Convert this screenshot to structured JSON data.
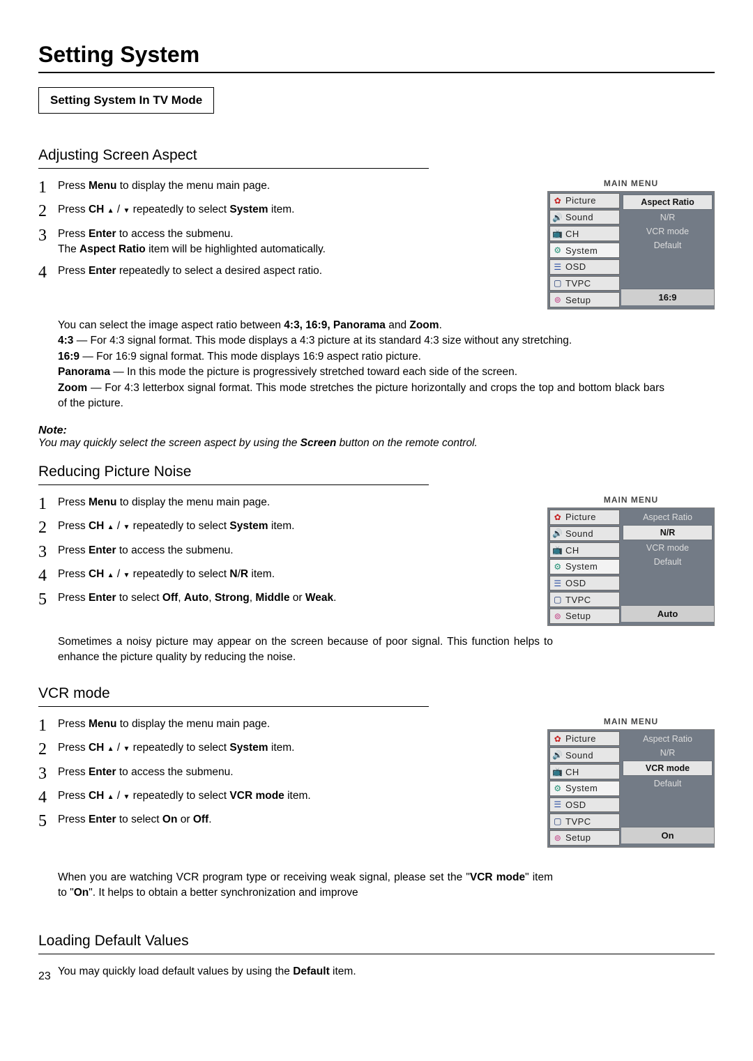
{
  "page_title": "Setting System",
  "subtitle_box": "Setting System In TV Mode",
  "page_number": "23",
  "section1": {
    "title": "Adjusting Screen Aspect",
    "steps": [
      {
        "n": "1",
        "html": "Press  <b>Menu</b> to display the menu main page."
      },
      {
        "n": "2",
        "html": "Press <b>CH</b> <span class='icon-tri-up'></span> / <span class='icon-tri-down'></span>  repeatedly to select <b>System</b> item."
      },
      {
        "n": "3",
        "html": "Press <b>Enter</b> to access the submenu.<br>The <b>Aspect Ratio</b> item will be highlighted automatically."
      },
      {
        "n": "4",
        "html": "Press <b>Enter</b> repeatedly to select a desired aspect ratio."
      }
    ],
    "def_html": "You can select the image aspect ratio between <b>4:3, 16:9, Panorama</b> and <b>Zoom</b>.<br><b>4:3</b> — For 4:3 signal format.  This mode displays a 4:3 picture at its standard 4:3 size without any stretching.<br><b>16:9</b> —  For 16:9 signal format.  This  mode  displays 16:9 aspect ratio picture.<br><b>Panorama</b> — In this mode the picture is progressively stretched toward each side of the screen.<br><b>Zoom</b> — For 4:3 letterbox signal format.  This mode stretches the picture horizontally and crops the top and bottom black bars of the picture.",
    "note_label": "Note:",
    "note": "You may quickly select the screen aspect by using the <b>Screen</b> button on the remote control.",
    "menu": {
      "title": "MAIN MENU",
      "items": [
        "Picture",
        "Sound",
        "CH",
        "System",
        "OSD",
        "TVPC",
        "Setup"
      ],
      "right_opts": [
        {
          "label": "Aspect Ratio",
          "hl": true
        },
        {
          "label": "N/R",
          "hl": false
        },
        {
          "label": "VCR mode",
          "hl": false
        },
        {
          "label": "Default",
          "hl": false
        }
      ],
      "value": "16:9"
    }
  },
  "section2": {
    "title": "Reducing Picture Noise",
    "steps": [
      {
        "n": "1",
        "html": "Press  <b>Menu</b> to display the menu main page."
      },
      {
        "n": "2",
        "html": "Press <b>CH</b> <span class='icon-tri-up'></span> / <span class='icon-tri-down'></span>  repeatedly to select <b>System</b> item."
      },
      {
        "n": "3",
        "html": "Press <b>Enter</b> to access the submenu."
      },
      {
        "n": "4",
        "html": "Press  <b>CH</b> <span class='icon-tri-up'></span> / <span class='icon-tri-down'></span>  repeatedly to select <b>N</b>/<b>R</b>  item."
      },
      {
        "n": "5",
        "html": "Press  <b>Enter</b> to select  <b>Off</b>, <b>Auto</b>, <b>Strong</b>, <b>Middle</b> or <b>Weak</b>."
      }
    ],
    "extra": "Sometimes a noisy picture may appear on the screen because of poor signal. This function helps to enhance the picture quality by reducing the noise.",
    "menu": {
      "title": "MAIN MENU",
      "items": [
        "Picture",
        "Sound",
        "CH",
        "System",
        "OSD",
        "TVPC",
        "Setup"
      ],
      "right_opts": [
        {
          "label": "Aspect Ratio",
          "hl": false
        },
        {
          "label": "N/R",
          "hl": true
        },
        {
          "label": "VCR mode",
          "hl": false
        },
        {
          "label": "Default",
          "hl": false
        }
      ],
      "value": "Auto"
    }
  },
  "section3": {
    "title": "VCR mode",
    "steps": [
      {
        "n": "1",
        "html": "Press  <b>Menu</b> to display the menu main page."
      },
      {
        "n": "2",
        "html": "Press <b>CH</b> <span class='icon-tri-up'></span> / <span class='icon-tri-down'></span>  repeatedly to select <b>System</b> item."
      },
      {
        "n": "3",
        "html": "Press <b>Enter</b> to access the submenu."
      },
      {
        "n": "4",
        "html": "Press  <b>CH</b> <span class='icon-tri-up'></span> / <span class='icon-tri-down'></span>  repeatedly to select <b>VCR mode</b> item."
      },
      {
        "n": "5",
        "html": "Press  <b>Enter</b> to select <b>On</b> or <b>Off</b>."
      }
    ],
    "extra": "When you are watching VCR program type or receiving weak signal, please set the \"<b>VCR mode</b>\" item to \"<b>On</b>\". It helps to obtain a better synchronization and improve",
    "menu": {
      "title": "MAIN MENU",
      "items": [
        "Picture",
        "Sound",
        "CH",
        "System",
        "OSD",
        "TVPC",
        "Setup"
      ],
      "right_opts": [
        {
          "label": "Aspect Ratio",
          "hl": false
        },
        {
          "label": "N/R",
          "hl": false
        },
        {
          "label": "VCR mode",
          "hl": true
        },
        {
          "label": "Default",
          "hl": false
        }
      ],
      "value": "On"
    }
  },
  "section4": {
    "title": "Loading Default Values",
    "text": "You may quickly load default values  by using the <b>Default</b> item."
  },
  "menu_item_colors": [
    "red",
    "orange",
    "green",
    "teal",
    "blue",
    "navy",
    "pink"
  ],
  "menu_item_icons": [
    "✿",
    "🔊",
    "📺",
    "⚙",
    "☰",
    "▢",
    "⊚"
  ]
}
